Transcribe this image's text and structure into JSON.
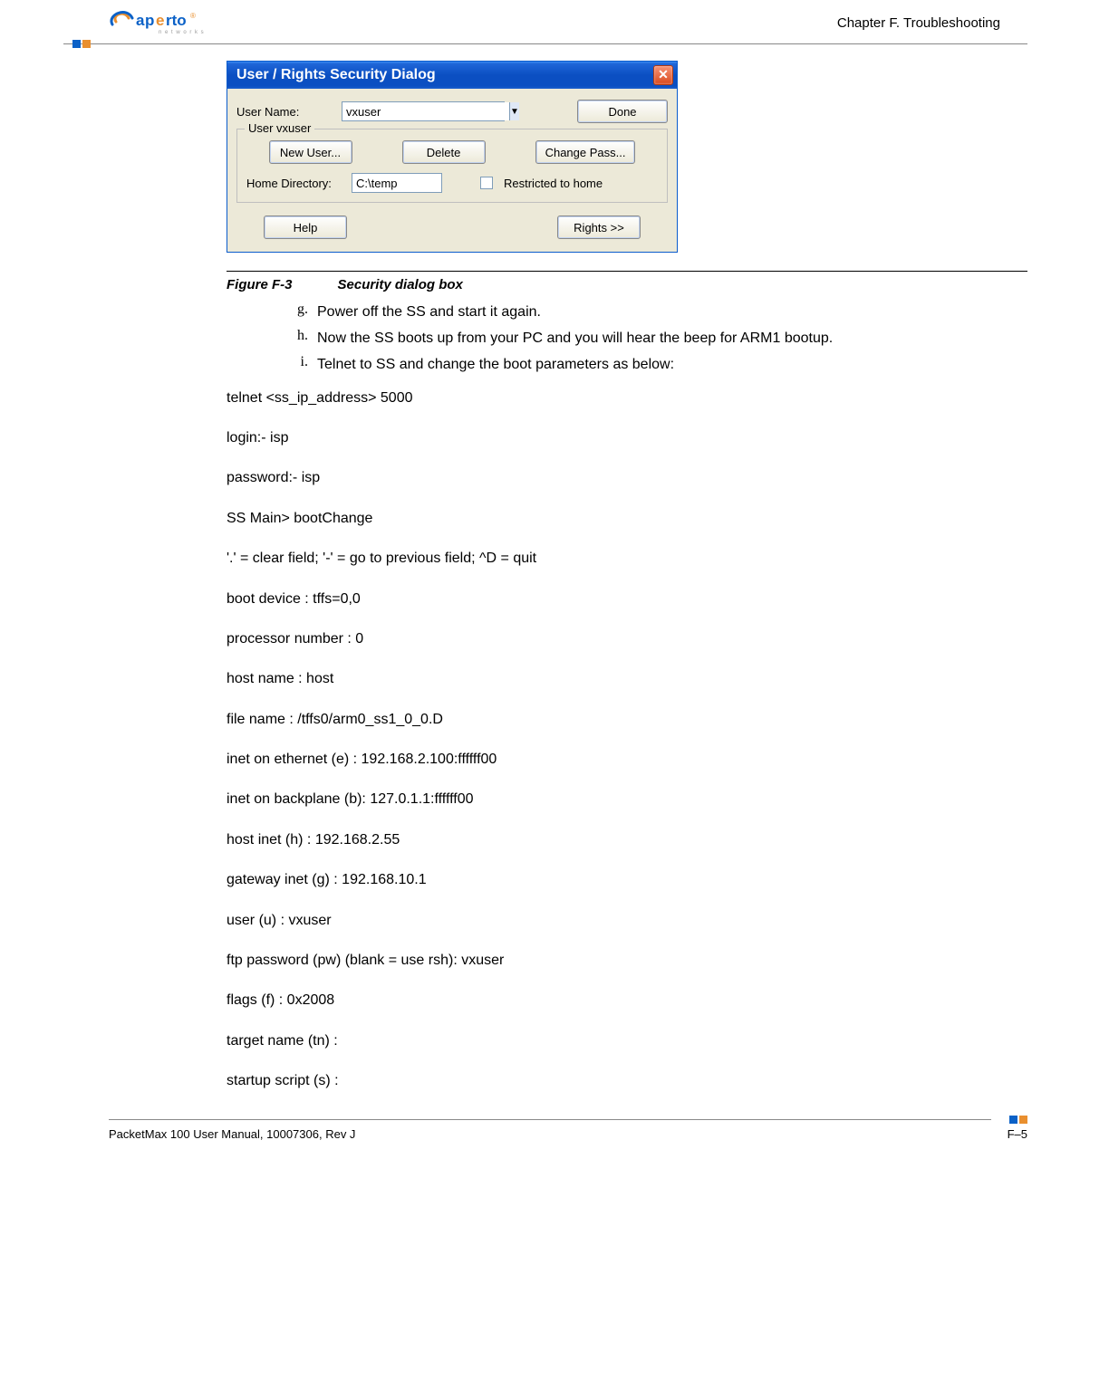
{
  "header": {
    "chapter": "Chapter F.  Troubleshooting",
    "logo_brand": "aperto",
    "logo_sub": "networks"
  },
  "dialog": {
    "title": "User / Rights Security Dialog",
    "close_label": "✕",
    "username_label": "User Name:",
    "username_value": "vxuser",
    "done_label": "Done",
    "fieldset_legend": "User vxuser",
    "new_user_label": "New User...",
    "delete_label": "Delete",
    "change_pass_label": "Change Pass...",
    "home_dir_label": "Home Directory:",
    "home_dir_value": "C:\\temp",
    "restricted_label": "Restricted to home",
    "help_label": "Help",
    "rights_label": "Rights >>"
  },
  "figure": {
    "number": "Figure F-3",
    "title": "Security dialog box"
  },
  "steps": [
    {
      "marker": "g.",
      "text": "Power off the SS and start it again."
    },
    {
      "marker": "h.",
      "text": "Now the SS boots up from your PC and you will hear the beep for ARM1 bootup."
    },
    {
      "marker": "i.",
      "text": "Telnet to SS and change the boot parameters as below:"
    }
  ],
  "terminal_lines": [
    "telnet <ss_ip_address> 5000",
    "login:- isp",
    "password:- isp",
    "SS Main> bootChange",
    " '.' = clear field;  '-' = go to previous field;  ^D = quit",
    "boot device          : tffs=0,0",
    "processor number     : 0",
    "host name            : host",
    "file name            : /tffs0/arm0_ss1_0_0.D",
    "inet on ethernet (e) : 192.168.2.100:ffffff00",
    "inet on backplane (b): 127.0.1.1:ffffff00",
    "host inet (h)        : 192.168.2.55",
    "gateway inet (g)     : 192.168.10.1",
    "user (u)             : vxuser",
    "ftp password (pw) (blank = use rsh): vxuser",
    "flags (f)            : 0x2008",
    "target name (tn)     :",
    "startup script (s)   :"
  ],
  "footer": {
    "manual": "PacketMax 100 User Manual, 10007306, Rev J",
    "page": "F–5"
  }
}
